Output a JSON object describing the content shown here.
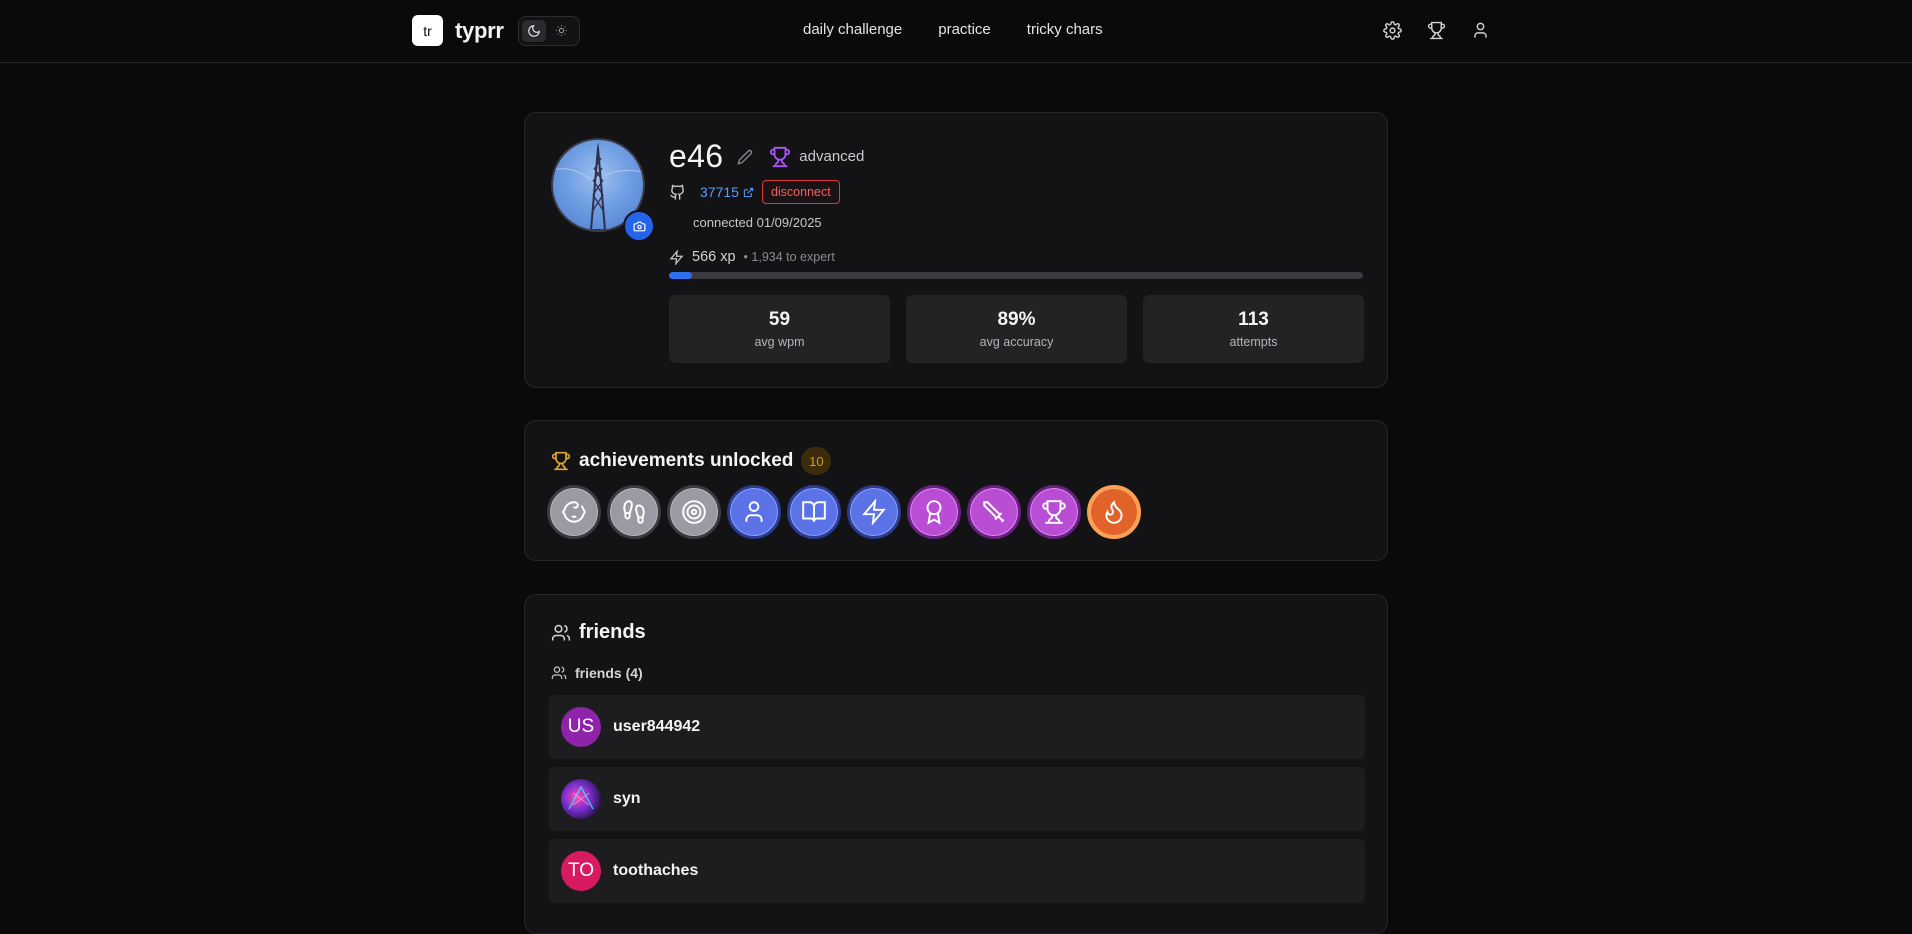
{
  "header": {
    "logo_text": "tr",
    "brand": "typrr",
    "nav": [
      "daily challenge",
      "practice",
      "tricky chars"
    ],
    "icons": [
      "settings-icon",
      "trophy-icon",
      "user-icon"
    ]
  },
  "profile": {
    "username": "e46",
    "rank": "advanced",
    "github_id": "37715",
    "disconnect_label": "disconnect",
    "connected_text": "connected 01/09/2025",
    "xp": "566 xp",
    "xp_next": "• 1,934 to expert",
    "xp_progress": 0.033,
    "stats": [
      {
        "value": "59",
        "label": "avg wpm"
      },
      {
        "value": "89%",
        "label": "avg accuracy"
      },
      {
        "value": "113",
        "label": "attempts"
      }
    ]
  },
  "achievements": {
    "title": "achievements unlocked",
    "count": "10",
    "badges": [
      {
        "icon": "baby-icon",
        "tier": "gray"
      },
      {
        "icon": "footprints-icon",
        "tier": "gray"
      },
      {
        "icon": "target-icon",
        "tier": "gray"
      },
      {
        "icon": "user-icon",
        "tier": "blue"
      },
      {
        "icon": "book-open-icon",
        "tier": "blue"
      },
      {
        "icon": "zap-icon",
        "tier": "blue"
      },
      {
        "icon": "award-icon",
        "tier": "purple"
      },
      {
        "icon": "sword-icon",
        "tier": "purple"
      },
      {
        "icon": "trophy-icon",
        "tier": "purple"
      },
      {
        "icon": "flame-icon",
        "tier": "orange"
      }
    ]
  },
  "friends": {
    "title": "friends",
    "subtitle": "friends (4)",
    "list": [
      {
        "initials": "US",
        "name": "user844942",
        "color": "#8e24aa"
      },
      {
        "initials": "",
        "name": "syn",
        "color": "#3a1a6e"
      },
      {
        "initials": "TO",
        "name": "toothaches",
        "color": "#d81b60"
      }
    ]
  },
  "colors": {
    "accent": "#2563eb",
    "danger": "#dc3b3b",
    "gold": "#d49a1e",
    "rank_purple": "#a855f7"
  }
}
